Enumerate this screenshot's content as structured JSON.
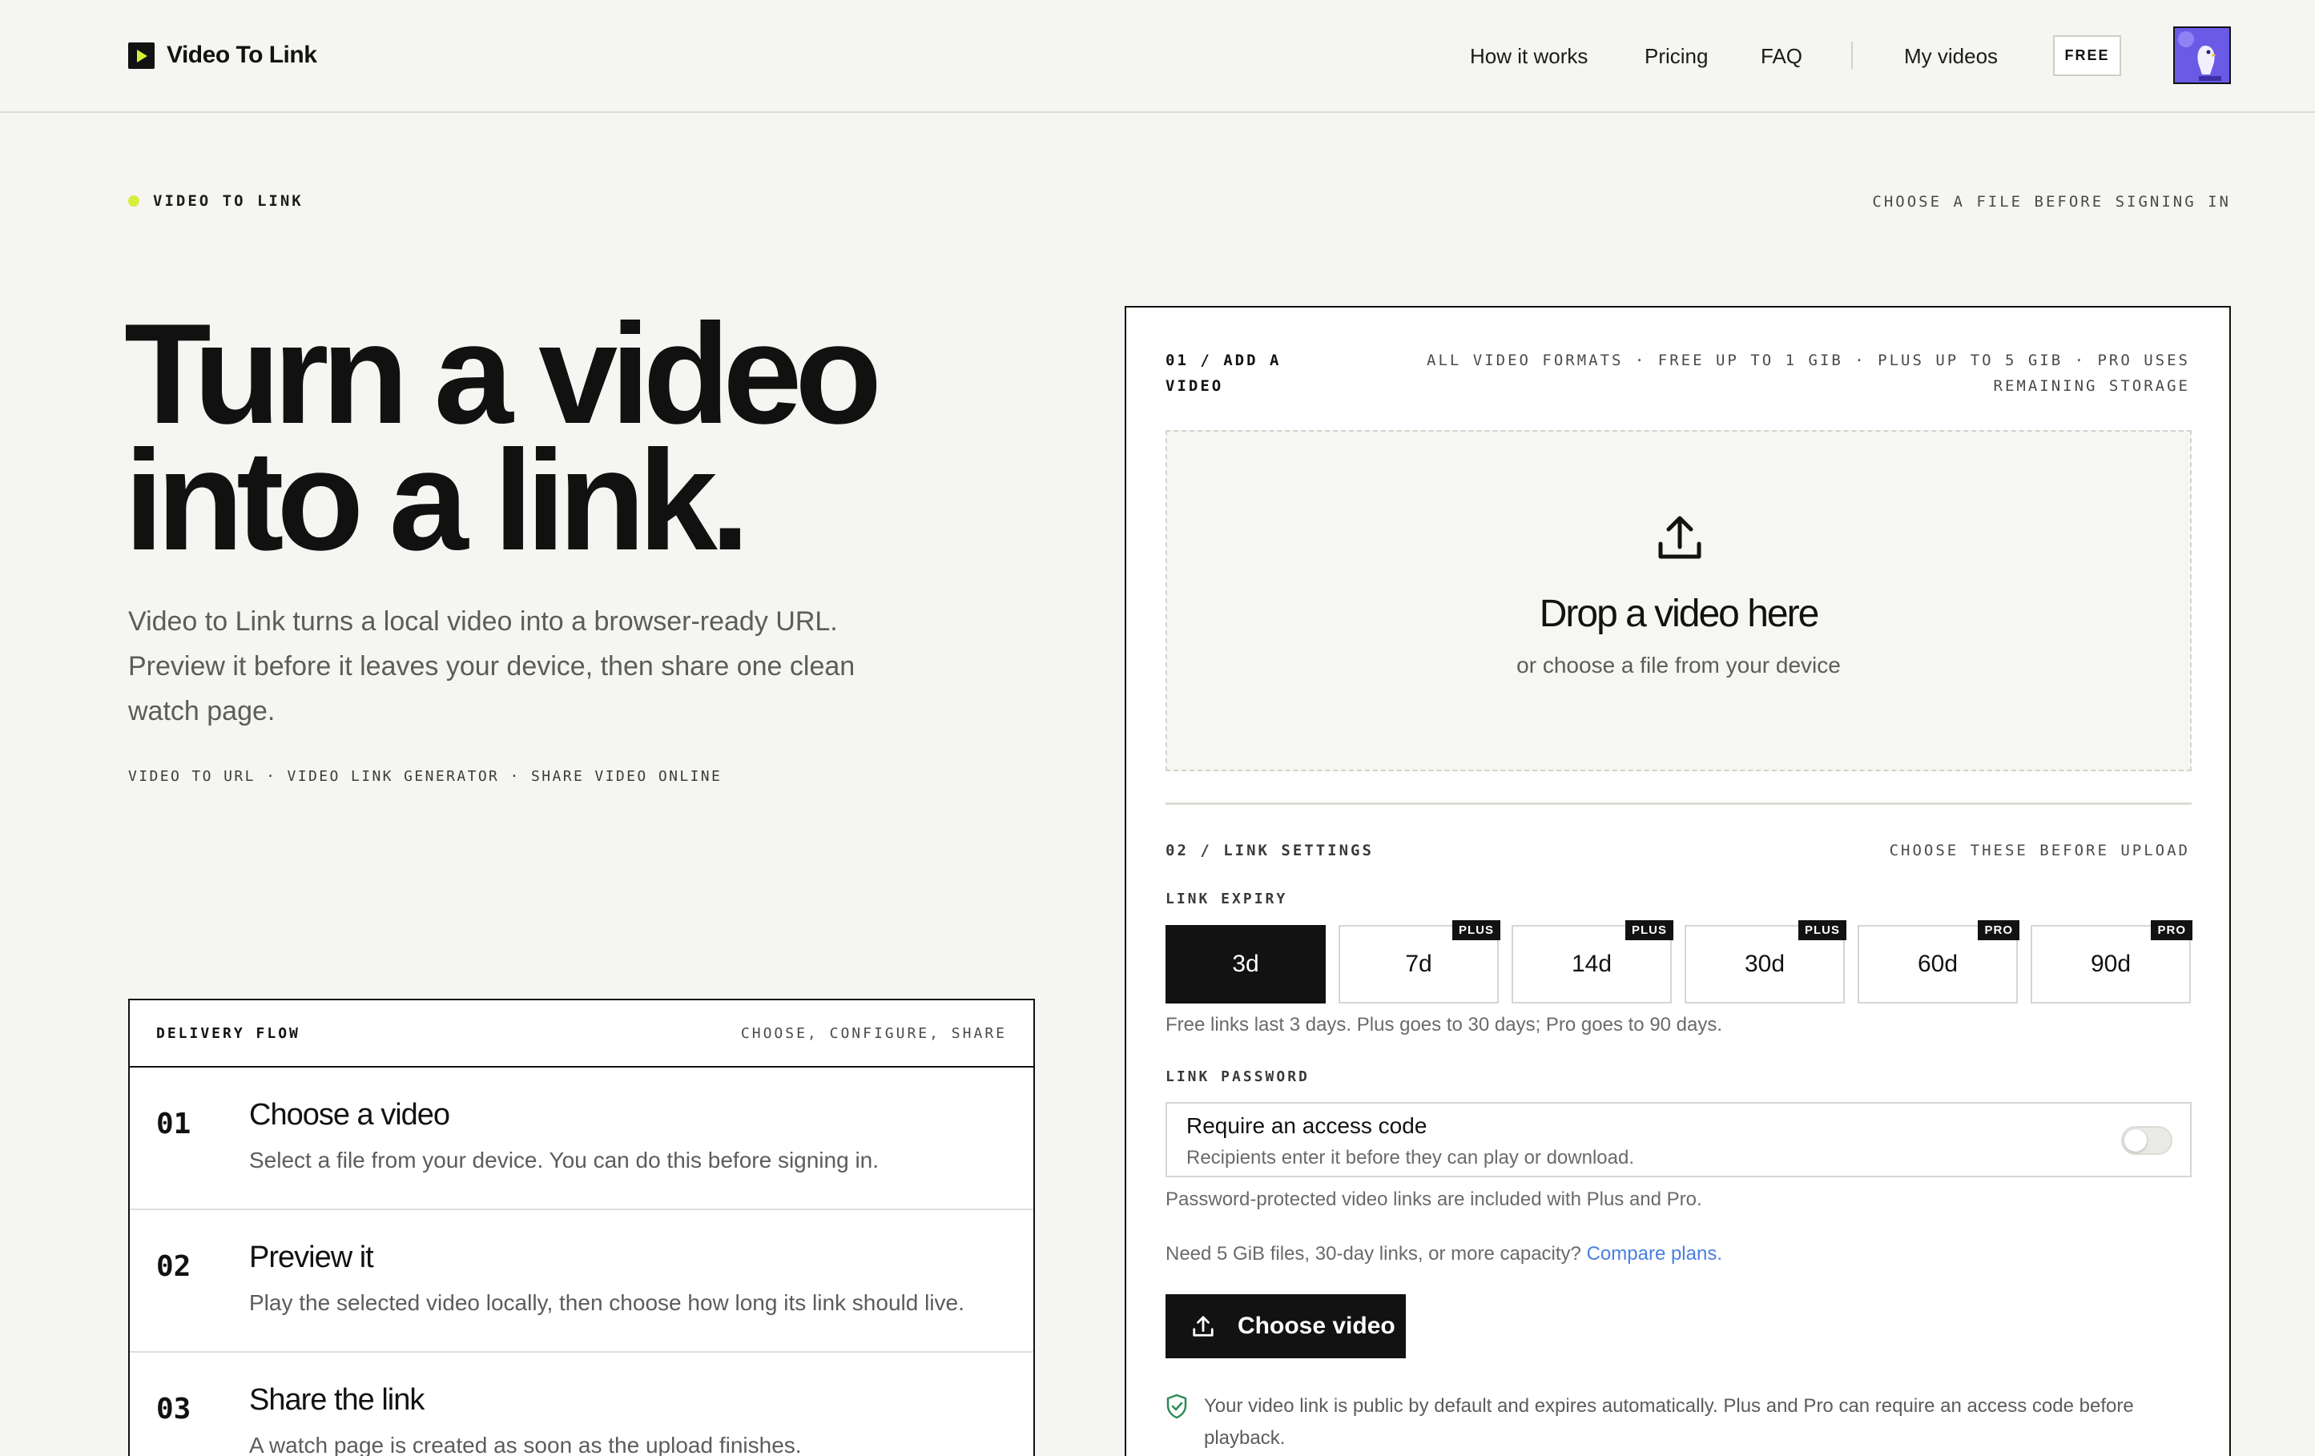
{
  "header": {
    "logo_text": "Video To Link",
    "nav": [
      "How it works",
      "Pricing",
      "FAQ"
    ],
    "my_videos": "My videos",
    "plan_badge": "FREE"
  },
  "hero": {
    "eyebrow": "VIDEO TO LINK",
    "eyebrow_right": "CHOOSE A FILE BEFORE SIGNING IN",
    "title_line1": "Turn a video",
    "title_line2": "into a link.",
    "description": "Video to Link turns a local video into a browser-ready URL. Preview it before it leaves your device, then share one clean watch page.",
    "tags": "VIDEO TO URL · VIDEO LINK GENERATOR · SHARE VIDEO ONLINE"
  },
  "flow": {
    "title": "DELIVERY FLOW",
    "subtitle": "CHOOSE, CONFIGURE, SHARE",
    "steps": [
      {
        "num": "01",
        "title": "Choose a video",
        "desc": "Select a file from your device. You can do this before signing in."
      },
      {
        "num": "02",
        "title": "Preview it",
        "desc": "Play the selected video locally, then choose how long its link should live."
      },
      {
        "num": "03",
        "title": "Share the link",
        "desc": "A watch page is created as soon as the upload finishes."
      }
    ]
  },
  "upload": {
    "step_label": "01 / ADD A VIDEO",
    "formats": "ALL VIDEO FORMATS · FREE UP TO 1 GIB · PLUS UP TO 5 GIB · PRO USES REMAINING STORAGE",
    "drop_title": "Drop a video here",
    "drop_subtitle": "or choose a file from your device"
  },
  "settings": {
    "step_label": "02 / LINK SETTINGS",
    "hint": "CHOOSE THESE BEFORE UPLOAD",
    "expiry_label": "LINK EXPIRY",
    "expiry_options": [
      {
        "label": "3d",
        "tier": "",
        "selected": true
      },
      {
        "label": "7d",
        "tier": "PLUS",
        "selected": false
      },
      {
        "label": "14d",
        "tier": "PLUS",
        "selected": false
      },
      {
        "label": "30d",
        "tier": "PLUS",
        "selected": false
      },
      {
        "label": "60d",
        "tier": "PRO",
        "selected": false
      },
      {
        "label": "90d",
        "tier": "PRO",
        "selected": false
      }
    ],
    "expiry_note": "Free links last 3 days. Plus goes to 30 days; Pro goes to 90 days.",
    "password_label": "LINK PASSWORD",
    "password_title": "Require an access code",
    "password_desc": "Recipients enter it before they can play or download.",
    "password_enabled": false,
    "password_note": "Password-protected video links are included with Plus and Pro.",
    "upsell_text": "Need 5 GiB files, 30-day links, or more capacity?",
    "upsell_link": "Compare plans.",
    "choose_button": "Choose video",
    "footnote": "Your video link is public by default and expires automatically. Plus and Pro can require an access code before playback."
  },
  "colors": {
    "accent": "#d7ee3b",
    "ink": "#121212",
    "background": "#f5f5f1",
    "link": "#4a7fe0"
  },
  "icons": [
    "play-logo-icon",
    "upload-icon",
    "shield-check-icon",
    "avatar-bird-icon"
  ]
}
